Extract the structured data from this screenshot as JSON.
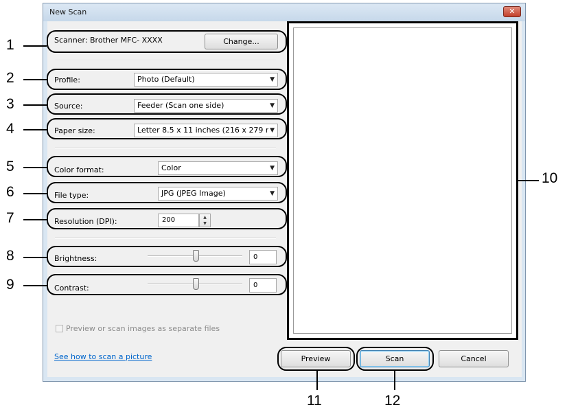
{
  "window": {
    "title": "New Scan",
    "close_glyph": "✕"
  },
  "scanner": {
    "label": "Scanner: Brother MFC- XXXX",
    "change_button": "Change..."
  },
  "profile": {
    "label": "Profile:",
    "value": "Photo (Default)"
  },
  "source": {
    "label": "Source:",
    "value": "Feeder (Scan one side)"
  },
  "paper_size": {
    "label": "Paper size:",
    "value": "Letter 8.5 x 11 inches (216 x 279 m"
  },
  "color_format": {
    "label": "Color format:",
    "value": "Color"
  },
  "file_type": {
    "label": "File type:",
    "value": "JPG (JPEG Image)"
  },
  "resolution": {
    "label": "Resolution (DPI):",
    "value": "200"
  },
  "brightness": {
    "label": "Brightness:",
    "value": "0"
  },
  "contrast": {
    "label": "Contrast:",
    "value": "0"
  },
  "separate_files": {
    "label": "Preview or scan images as separate files",
    "checked": false
  },
  "help_link": "See how to scan a picture",
  "buttons": {
    "preview": "Preview",
    "scan": "Scan",
    "cancel": "Cancel"
  },
  "callouts": {
    "c1": "1",
    "c2": "2",
    "c3": "3",
    "c4": "4",
    "c5": "5",
    "c6": "6",
    "c7": "7",
    "c8": "8",
    "c9": "9",
    "c10": "10",
    "c11": "11",
    "c12": "12"
  },
  "icons": {
    "dropdown": "chevron-down-icon",
    "spin": "spin-arrows-icon",
    "close": "close-icon"
  }
}
